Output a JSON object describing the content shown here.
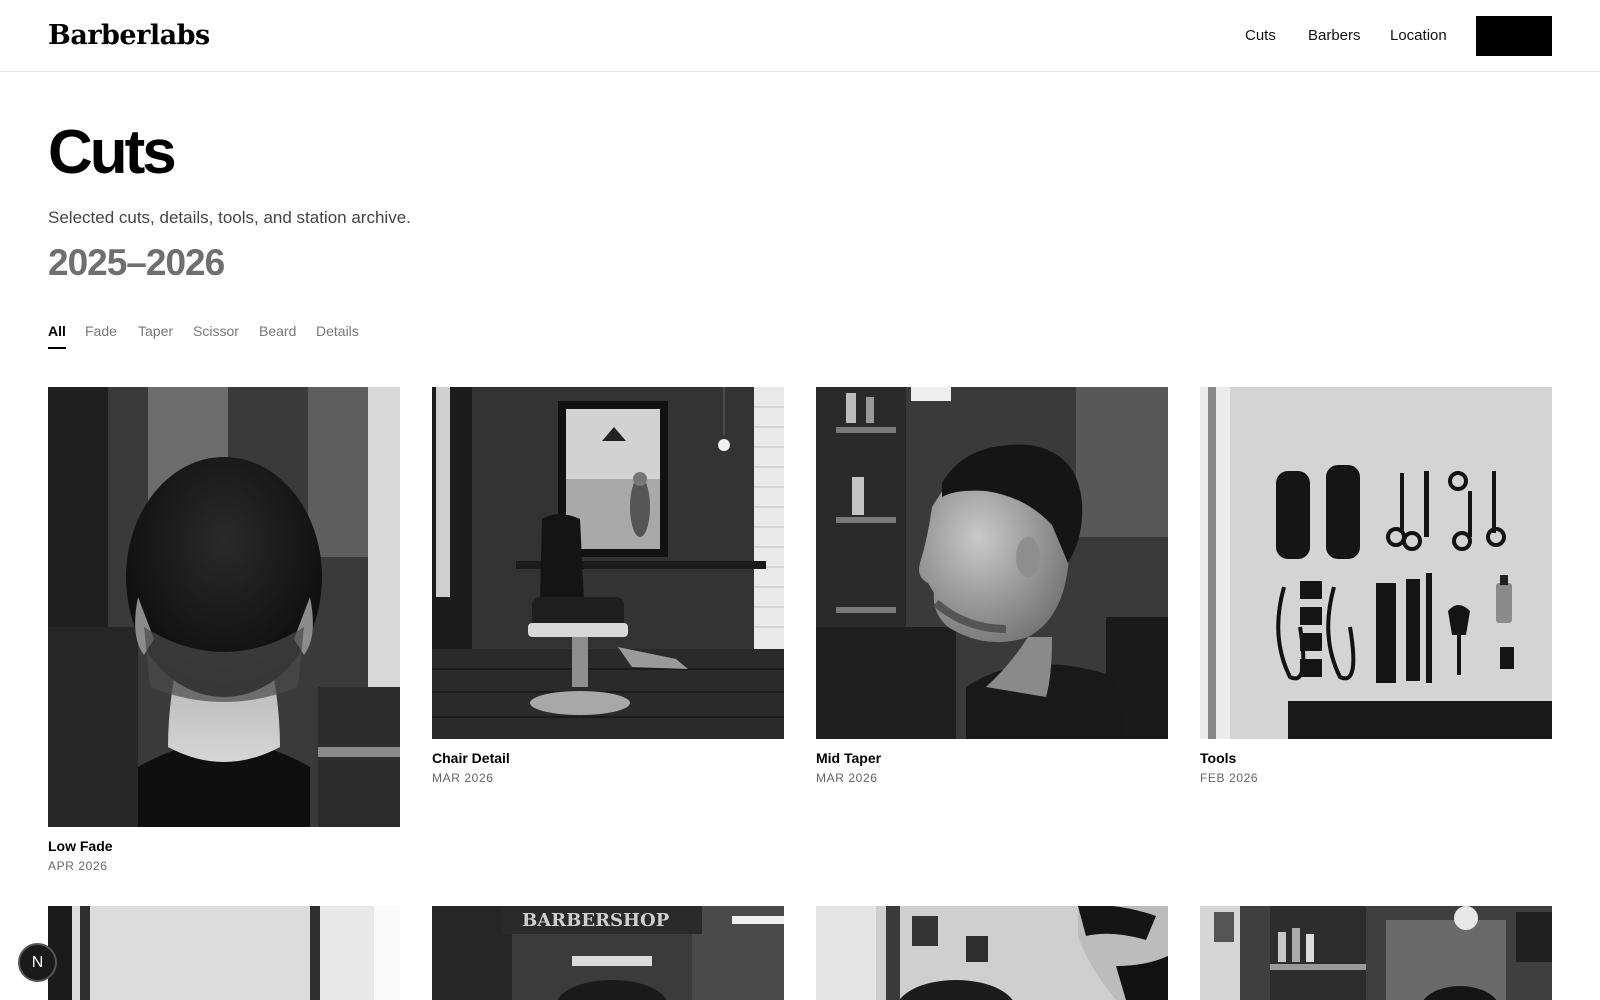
{
  "brand": {
    "logo_text": "Barberlabs"
  },
  "nav": {
    "items": [
      "Cuts",
      "Barbers",
      "Location"
    ]
  },
  "hero": {
    "title": "Cuts",
    "subtitle": "Selected cuts, details, tools, and station archive.",
    "years": "2025–2026"
  },
  "filters": {
    "items": [
      "All",
      "Fade",
      "Taper",
      "Scissor",
      "Beard",
      "Details"
    ],
    "active": "All"
  },
  "gallery": [
    {
      "title": "Low Fade",
      "date": "APR 2026"
    },
    {
      "title": "Chair Detail",
      "date": "MAR 2026"
    },
    {
      "title": "Mid Taper",
      "date": "MAR 2026"
    },
    {
      "title": "Tools",
      "date": "FEB 2026"
    }
  ],
  "second_row_signage": "BARBERSHOP",
  "fab": {
    "label": "N"
  },
  "colors": {
    "accent": "#000000",
    "muted": "#6f6f6f",
    "border": "#e6e6e6"
  }
}
